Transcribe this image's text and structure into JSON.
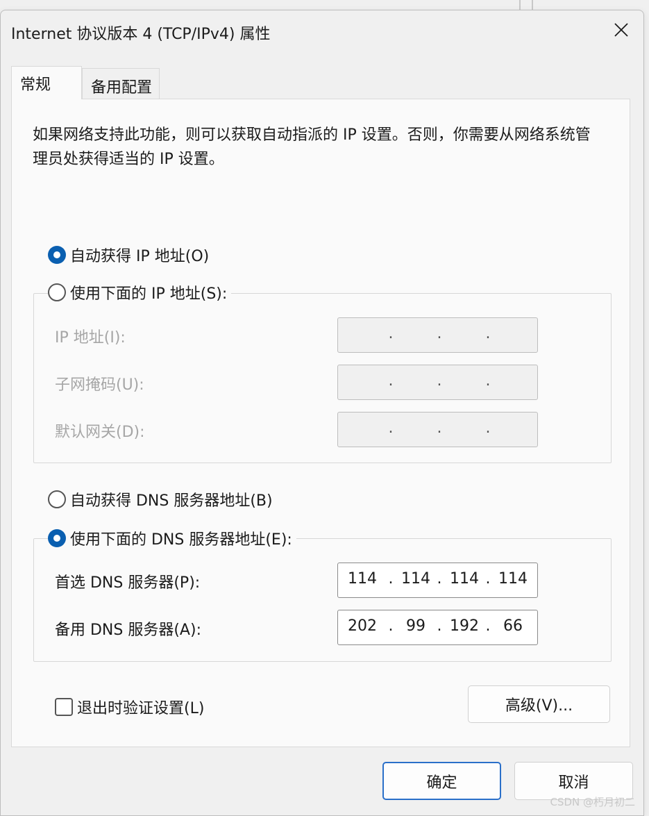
{
  "dialog": {
    "title": "Internet 协议版本 4 (TCP/IPv4) 属性"
  },
  "tabs": [
    {
      "label": "常规",
      "active": true
    },
    {
      "label": "备用配置",
      "active": false
    }
  ],
  "general": {
    "description": "如果网络支持此功能，则可以获取自动指派的 IP 设置。否则，你需要从网络系统管理员处获得适当的 IP 设置。",
    "ip_mode": {
      "auto_label": "自动获得 IP 地址(O)",
      "manual_label": "使用下面的 IP 地址(S):",
      "selected": "auto"
    },
    "ip_fields": {
      "ip_label": "IP 地址(I):",
      "mask_label": "子网掩码(U):",
      "gateway_label": "默认网关(D):",
      "ip_value": [
        "",
        "",
        "",
        ""
      ],
      "mask_value": [
        "",
        "",
        "",
        ""
      ],
      "gateway_value": [
        "",
        "",
        "",
        ""
      ]
    },
    "dns_mode": {
      "auto_label": "自动获得 DNS 服务器地址(B)",
      "manual_label": "使用下面的 DNS 服务器地址(E):",
      "selected": "manual"
    },
    "dns_fields": {
      "preferred_label": "首选 DNS 服务器(P):",
      "alternate_label": "备用 DNS 服务器(A):",
      "preferred_value": [
        "114",
        "114",
        "114",
        "114"
      ],
      "alternate_value": [
        "202",
        "99",
        "192",
        "66"
      ]
    },
    "validate_label": "退出时验证设置(L)",
    "validate_checked": false,
    "advanced_label": "高级(V)..."
  },
  "footer": {
    "ok_label": "确定",
    "cancel_label": "取消"
  },
  "watermark": "CSDN @朽月初二",
  "colors": {
    "accent": "#0a5fb0",
    "primary_button_border": "#2a6fc9",
    "disabled_text": "#a6a6a6"
  }
}
